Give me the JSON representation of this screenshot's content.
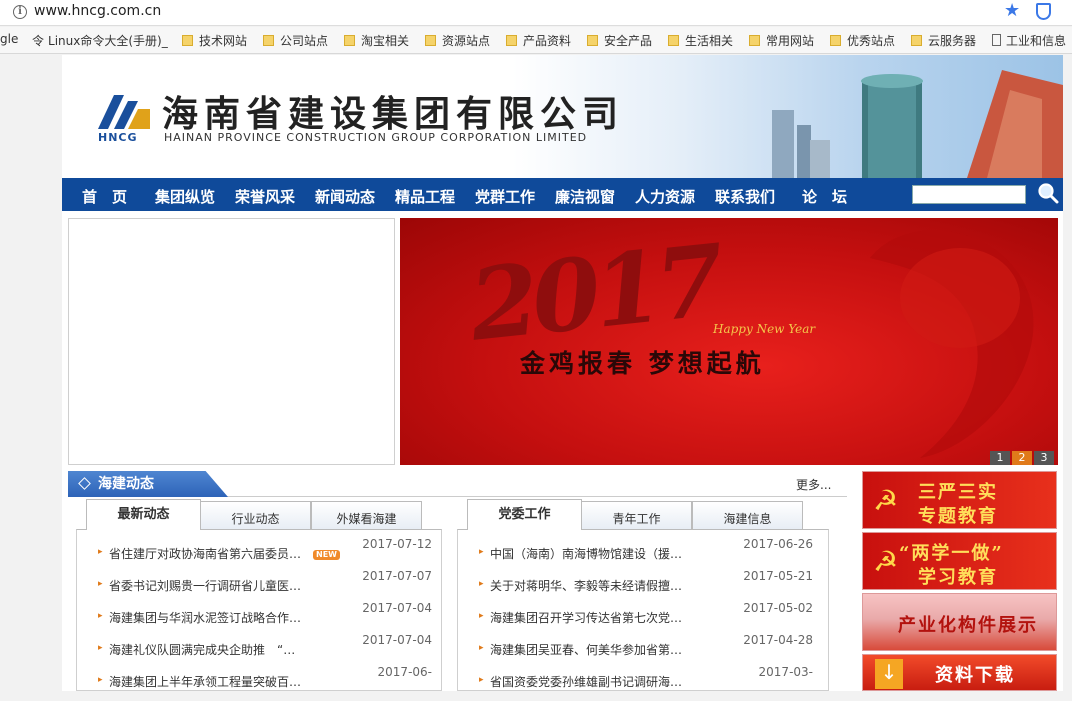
{
  "browser": {
    "url": "www.hncg.com.cn",
    "bookmarks": [
      "gle",
      "Linux命令大全(手册)_",
      "技术网站",
      "公司站点",
      "淘宝相关",
      "资源站点",
      "产品资料",
      "安全产品",
      "生活相关",
      "常用网站",
      "优秀站点",
      "云服务器",
      "工业和信息"
    ]
  },
  "header": {
    "logo_text": "HNCG",
    "company_cn": "海南省建设集团有限公司",
    "company_en": "HAINAN PROVINCE CONSTRUCTION GROUP CORPORATION LIMITED"
  },
  "nav": {
    "items": [
      "首　页",
      "集团纵览",
      "荣誉风采",
      "新闻动态",
      "精品工程",
      "党群工作",
      "廉洁视窗",
      "人力资源",
      "联系我们",
      "论　坛"
    ],
    "search_placeholder": ""
  },
  "slide": {
    "year": "2017",
    "greeting": "Happy New Year",
    "slogan": "金鸡报春  梦想起航",
    "pages": [
      "1",
      "2",
      "3"
    ],
    "active_page": "2"
  },
  "news": {
    "section_title": "海建动态",
    "more": "更多...",
    "left_tabs": [
      "最新动态",
      "行业动态",
      "外媒看海建"
    ],
    "right_tabs": [
      "党委工作",
      "青年工作",
      "海建信息"
    ],
    "new_badge": "NEW",
    "left_items": [
      {
        "title": "省住建厅对政协海南省第六届委员…",
        "date": "2017-07-12",
        "is_new": true
      },
      {
        "title": "省委书记刘赐贵一行调研省儿童医…",
        "date": "2017-07-07",
        "is_new": false
      },
      {
        "title": "海建集团与华润水泥签订战略合作…",
        "date": "2017-07-04",
        "is_new": false
      },
      {
        "title": "海建礼仪队圆满完成央企助推　“…",
        "date": "2017-07-04",
        "is_new": false
      },
      {
        "title": "海建集团上半年承领工程量突破百…",
        "date": "2017-06-",
        "is_new": false
      }
    ],
    "right_items": [
      {
        "title": "中国（海南）南海博物馆建设（援…",
        "date": "2017-06-26"
      },
      {
        "title": "关于对蒋明华、李毅等未经请假擅…",
        "date": "2017-05-21"
      },
      {
        "title": "海建集团召开学习传达省第七次党…",
        "date": "2017-05-02"
      },
      {
        "title": "海建集团吴亚春、何美华参加省第…",
        "date": "2017-04-28"
      },
      {
        "title": "省国资委党委孙维雄副书记调研海…",
        "date": "2017-03-"
      }
    ]
  },
  "side_banners": [
    {
      "line1": "三严三实",
      "line2": "专题教育"
    },
    {
      "line1": "“两学一做”",
      "line2": "学习教育"
    },
    {
      "line1": "产业化构件展示",
      "line2": ""
    },
    {
      "line1": "资料下载",
      "line2": ""
    }
  ],
  "colors": {
    "nav_bg": "#0f4a9a",
    "accent_red": "#c40f0f",
    "brand_blue": "#1a4f9c"
  }
}
